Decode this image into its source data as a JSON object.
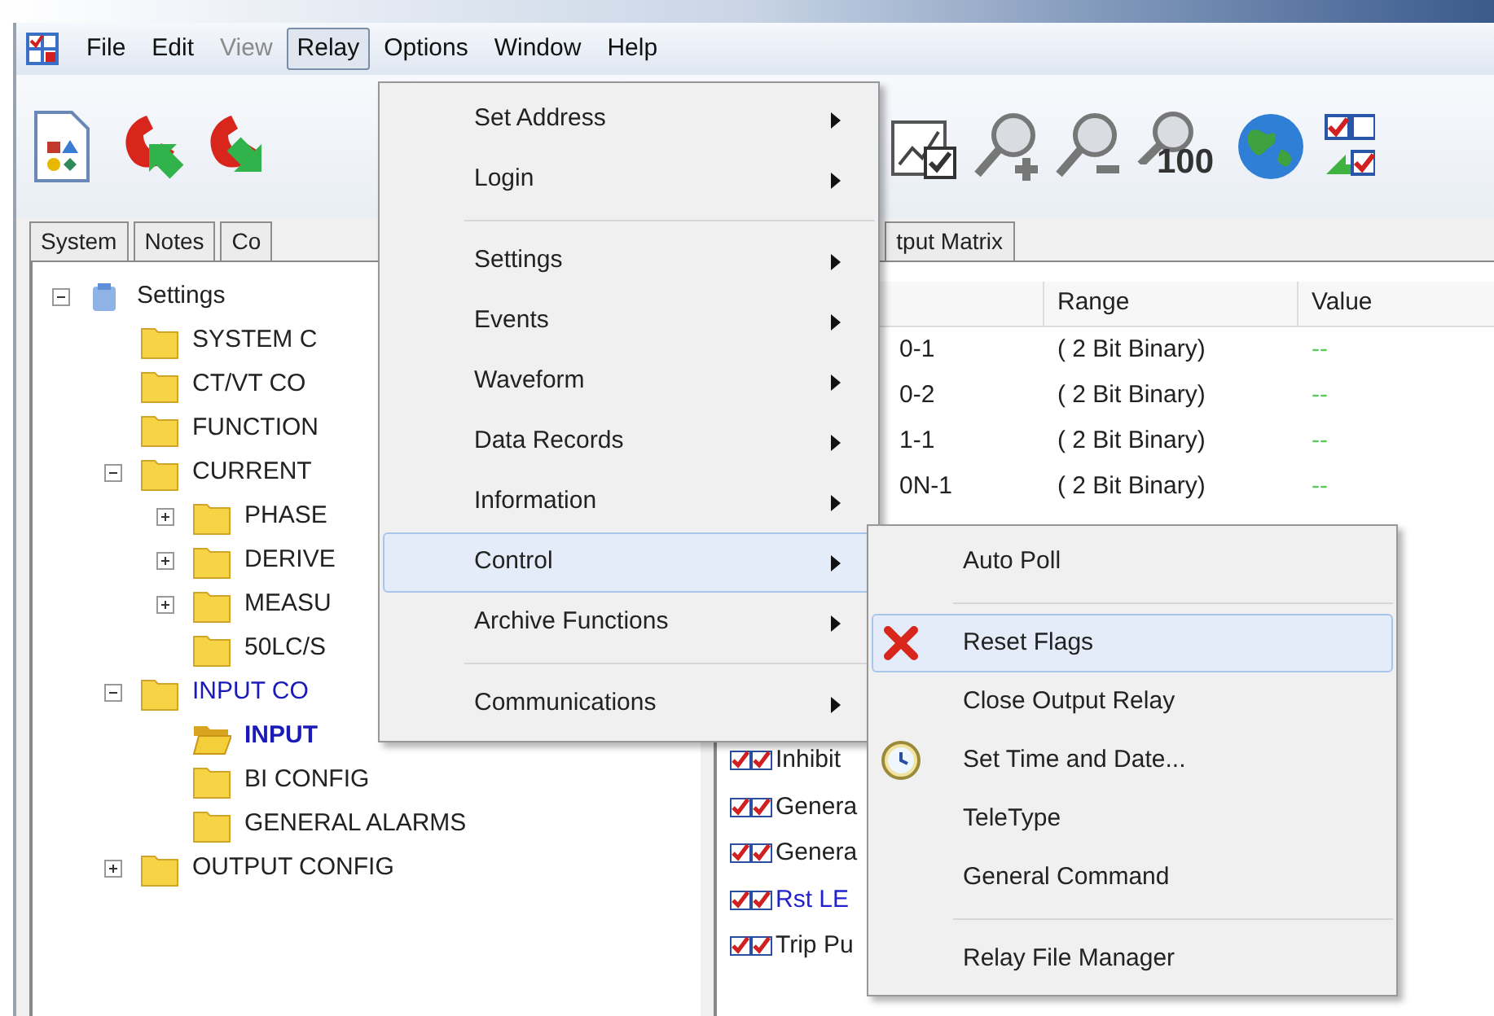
{
  "menu_bar": [
    {
      "label": "File",
      "disabled": false,
      "selected": false
    },
    {
      "label": "Edit",
      "disabled": false,
      "selected": false
    },
    {
      "label": "View",
      "disabled": true,
      "selected": false
    },
    {
      "label": "Relay",
      "disabled": false,
      "selected": true
    },
    {
      "label": "Options",
      "disabled": false,
      "selected": false
    },
    {
      "label": "Window",
      "disabled": false,
      "selected": false
    },
    {
      "label": "Help",
      "disabled": false,
      "selected": false
    }
  ],
  "toolbar": {
    "zoom_reset_label": "100"
  },
  "tabs": [
    {
      "label": "System"
    },
    {
      "label": "Notes"
    },
    {
      "label": "Co"
    },
    {
      "label": "tput Matrix"
    }
  ],
  "tree": [
    {
      "label": "Settings",
      "kind": "root",
      "expanded": true,
      "selected": false,
      "highlighted": false,
      "children": [
        {
          "label": "SYSTEM C",
          "kind": "folder",
          "selected": false,
          "highlighted": false
        },
        {
          "label": "CT/VT CO",
          "kind": "folder",
          "selected": false,
          "highlighted": false
        },
        {
          "label": "FUNCTION",
          "kind": "folder",
          "selected": false,
          "highlighted": false
        },
        {
          "label": "CURRENT",
          "kind": "folder",
          "expanded": true,
          "selected": false,
          "highlighted": false,
          "children": [
            {
              "label": "PHASE",
              "kind": "folder",
              "expanded": false,
              "selected": false,
              "highlighted": false
            },
            {
              "label": "DERIVE",
              "kind": "folder",
              "expanded": false,
              "selected": false,
              "highlighted": false
            },
            {
              "label": "MEASU",
              "kind": "folder",
              "expanded": false,
              "selected": false,
              "highlighted": false
            },
            {
              "label": "50LC/S",
              "kind": "folder",
              "selected": false,
              "highlighted": false
            }
          ]
        },
        {
          "label": "INPUT CO",
          "kind": "folder",
          "expanded": true,
          "selected": false,
          "highlighted": true,
          "children": [
            {
              "label": "INPUT",
              "kind": "folder",
              "selected": true,
              "highlighted": true
            },
            {
              "label": "BI CONFIG",
              "kind": "folder",
              "selected": false,
              "highlighted": false
            },
            {
              "label": "GENERAL ALARMS",
              "kind": "folder",
              "selected": false,
              "highlighted": false
            }
          ]
        },
        {
          "label": "OUTPUT CONFIG",
          "kind": "folder",
          "expanded": false,
          "selected": false,
          "highlighted": false
        }
      ]
    }
  ],
  "table": {
    "columns": [
      "Range",
      "Value"
    ],
    "rows": [
      {
        "column_1": "0-1",
        "range": "( 2 Bit Binary)",
        "value": "--"
      },
      {
        "column_1": "0-2",
        "range": "( 2 Bit Binary)",
        "value": "--"
      },
      {
        "column_1": "1-1",
        "range": "( 2 Bit Binary)",
        "value": "--"
      },
      {
        "column_1": "0N-1",
        "range": "( 2 Bit Binary)",
        "value": "--"
      }
    ]
  },
  "lower_list": [
    {
      "label": "Inhibit",
      "color": "#222222"
    },
    {
      "label": "Genera",
      "color": "#222222"
    },
    {
      "label": "Genera",
      "color": "#222222"
    },
    {
      "label": "Rst LE",
      "color": "#2222cc"
    },
    {
      "label": "Trip Pu",
      "color": "#222222"
    }
  ],
  "relay_menu": [
    {
      "kind": "item",
      "label": "Set Address",
      "submenu": true,
      "highlighted": false
    },
    {
      "kind": "item",
      "label": "Login",
      "submenu": true,
      "highlighted": false
    },
    {
      "kind": "separator"
    },
    {
      "kind": "item",
      "label": "Settings",
      "submenu": true,
      "highlighted": false
    },
    {
      "kind": "item",
      "label": "Events",
      "submenu": true,
      "highlighted": false
    },
    {
      "kind": "item",
      "label": "Waveform",
      "submenu": true,
      "highlighted": false
    },
    {
      "kind": "item",
      "label": "Data Records",
      "submenu": true,
      "highlighted": false
    },
    {
      "kind": "item",
      "label": "Information",
      "submenu": true,
      "highlighted": false
    },
    {
      "kind": "item",
      "label": "Control",
      "submenu": true,
      "highlighted": true
    },
    {
      "kind": "item",
      "label": "Archive Functions",
      "submenu": true,
      "highlighted": false
    },
    {
      "kind": "separator"
    },
    {
      "kind": "item",
      "label": "Communications",
      "submenu": true,
      "highlighted": false
    }
  ],
  "control_submenu": [
    {
      "kind": "item",
      "label": "Auto Poll",
      "highlighted": false
    },
    {
      "kind": "separator"
    },
    {
      "kind": "cross",
      "label": "Reset Flags",
      "highlighted": true
    },
    {
      "kind": "item",
      "label": "Close Output Relay",
      "highlighted": false
    },
    {
      "kind": "clock",
      "label": "Set Time and Date...",
      "highlighted": false
    },
    {
      "kind": "item",
      "label": "TeleType",
      "highlighted": false
    },
    {
      "kind": "item",
      "label": "General Command",
      "highlighted": false
    },
    {
      "kind": "separator"
    },
    {
      "kind": "item",
      "label": "Relay File Manager",
      "highlighted": false
    }
  ]
}
